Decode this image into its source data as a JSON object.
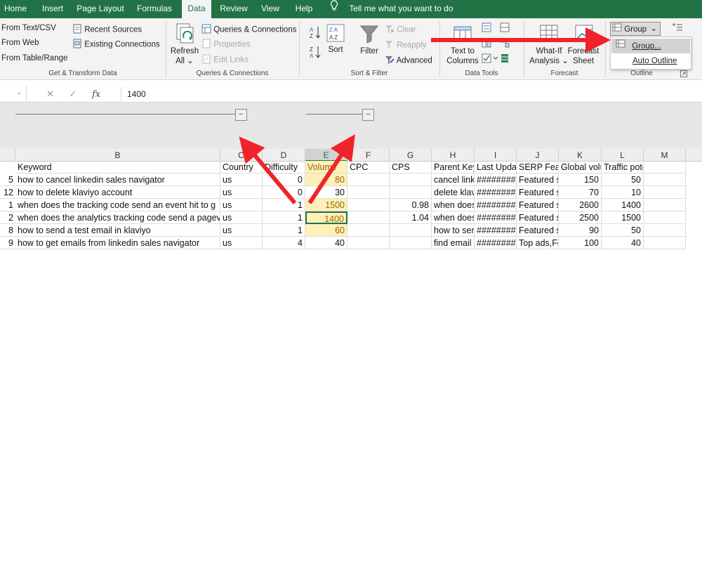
{
  "menu": {
    "tabs": [
      "Home",
      "Insert",
      "Page Layout",
      "Formulas",
      "Data",
      "Review",
      "View",
      "Help"
    ],
    "active_tab": "Data",
    "tell_me": "Tell me what you want to do"
  },
  "ribbon": {
    "get_transform": {
      "from_text_csv": "From Text/CSV",
      "from_web": "From Web",
      "from_table_range": "From Table/Range",
      "recent_sources": "Recent Sources",
      "existing_connections": "Existing Connections",
      "group_label": "Get & Transform Data"
    },
    "queries": {
      "refresh_all": "Refresh",
      "refresh_all_2": "All",
      "queries_connections": "Queries & Connections",
      "properties": "Properties",
      "edit_links": "Edit Links",
      "group_label": "Queries & Connections"
    },
    "sort_filter": {
      "sort": "Sort",
      "filter": "Filter",
      "clear": "Clear",
      "reapply": "Reapply",
      "advanced": "Advanced",
      "group_label": "Sort & Filter"
    },
    "data_tools": {
      "text_to_columns_1": "Text to",
      "text_to_columns_2": "Columns",
      "group_label": "Data Tools"
    },
    "forecast": {
      "what_if_1": "What-If",
      "what_if_2": "Analysis",
      "forecast_sheet_1": "Forecast",
      "forecast_sheet_2": "Sheet",
      "group_label": "Forecast"
    },
    "outline": {
      "group_button": "Group",
      "group_label": "Outline"
    }
  },
  "dropdown": {
    "items": [
      "Group...",
      "Auto Outline"
    ]
  },
  "formula_bar": {
    "name_box": "",
    "value": "1400"
  },
  "columns": [
    "B",
    "C",
    "D",
    "E",
    "F",
    "G",
    "H",
    "I",
    "J",
    "K",
    "L",
    "M"
  ],
  "selected_column": "E",
  "header_row": [
    "Keyword",
    "Country",
    "Difficulty",
    "Volume",
    "CPC",
    "CPS",
    "Parent Keyword",
    "Last Update",
    "SERP Features",
    "Global volume",
    "Traffic potential",
    ""
  ],
  "rows": [
    {
      "rowno": "5",
      "cells": [
        "how to cancel linkedin sales navigator",
        "us",
        "0",
        "80",
        "",
        "",
        "cancel linkedin",
        "########",
        "Featured s",
        "150",
        "50",
        ""
      ]
    },
    {
      "rowno": "12",
      "cells": [
        "how to delete klaviyo account",
        "us",
        "0",
        "30",
        "",
        "",
        "delete klaviyo",
        "########",
        "Featured s",
        "70",
        "10",
        ""
      ]
    },
    {
      "rowno": "1",
      "cells": [
        "when does the tracking code send an event hit to g",
        "us",
        "1",
        "1500",
        "",
        "0.98",
        "when does",
        "########",
        "Featured s",
        "2600",
        "1400",
        ""
      ]
    },
    {
      "rowno": "2",
      "cells": [
        "when does the analytics tracking code send a pageview",
        "us",
        "1",
        "1400",
        "",
        "1.04",
        "when does",
        "########",
        "Featured s",
        "2500",
        "1500",
        ""
      ]
    },
    {
      "rowno": "8",
      "cells": [
        "how to send a test email in klaviyo",
        "us",
        "1",
        "60",
        "",
        "",
        "how to send",
        "########",
        "Featured s",
        "90",
        "50",
        ""
      ]
    },
    {
      "rowno": "9",
      "cells": [
        "how to get emails from linkedin sales navigator",
        "us",
        "4",
        "40",
        "",
        "",
        "find email",
        "########",
        "Top ads,Fe",
        "100",
        "40",
        ""
      ]
    }
  ],
  "colors": {
    "excel_green": "#217346",
    "arrow_red": "#f0232a",
    "highlight_fill": "#fdf0b8",
    "highlight_text": "#9c6500"
  }
}
